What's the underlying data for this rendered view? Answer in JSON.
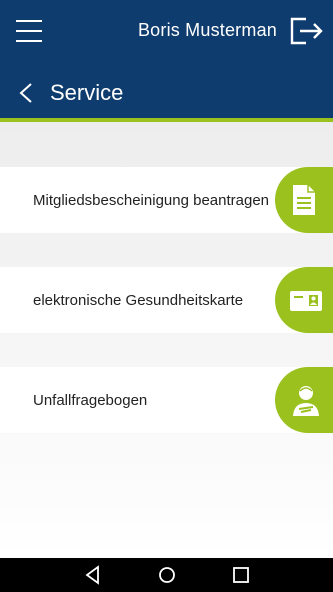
{
  "header": {
    "user_name": "Boris Musterman",
    "page_title": "Service"
  },
  "service_items": [
    {
      "label": "Mitgliedsbescheinigung beantragen",
      "icon": "document-icon"
    },
    {
      "label": "elektronische Gesundheitskarte",
      "icon": "health-card-icon"
    },
    {
      "label": "Unfallfragebogen",
      "icon": "injured-person-icon"
    }
  ],
  "colors": {
    "header_bg": "#0f3c6e",
    "accent_green": "#9bc11f"
  },
  "system_nav": [
    "back-icon",
    "home-icon",
    "recents-icon"
  ]
}
